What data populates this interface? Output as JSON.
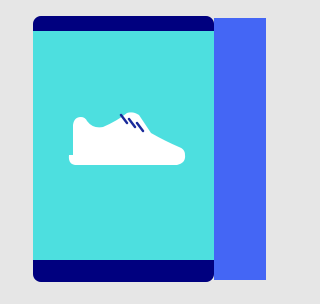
{
  "colors": {
    "background": "#e6e6e6",
    "card_header": "#00007f",
    "card_body": "#4ddfdf",
    "card_footer": "#00007f",
    "accent_panel": "#4466f5",
    "shoe": "#ffffff",
    "shoe_laces": "#1a2a9a"
  },
  "card": {
    "icon": "sneaker-icon"
  }
}
